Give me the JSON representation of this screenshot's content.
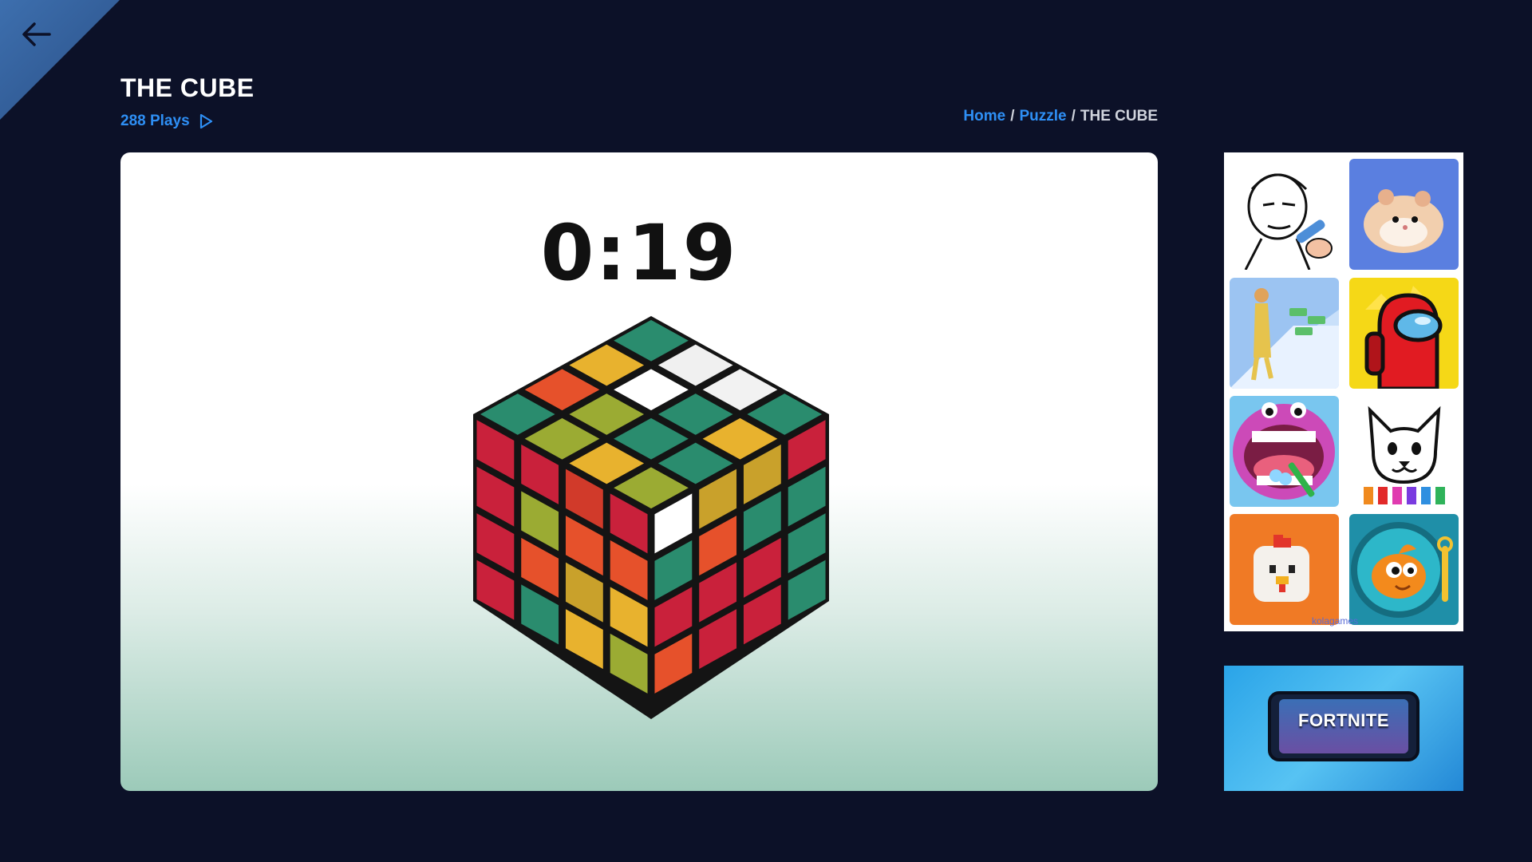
{
  "header": {
    "title": "THE CUBE",
    "plays": "288 Plays"
  },
  "breadcrumb": {
    "home": "Home",
    "separator": "/",
    "category": "Puzzle",
    "current": "THE CUBE"
  },
  "game": {
    "timer": "0:19"
  },
  "sidebar": {
    "watermark": "kolagames",
    "thumbnails": [
      {
        "icon": "drawing-face-icon"
      },
      {
        "icon": "hamster-icon"
      },
      {
        "icon": "runner-girl-icon"
      },
      {
        "icon": "among-us-icon"
      },
      {
        "icon": "hippo-dentist-icon"
      },
      {
        "icon": "cat-coloring-icon"
      },
      {
        "icon": "chicken-icon"
      },
      {
        "icon": "fish-icon"
      }
    ]
  },
  "ad": {
    "text": "FORTNITE"
  },
  "colors": {
    "background": "#0c1128",
    "accent": "#2e8ff5",
    "corner": "#3d6fae"
  }
}
